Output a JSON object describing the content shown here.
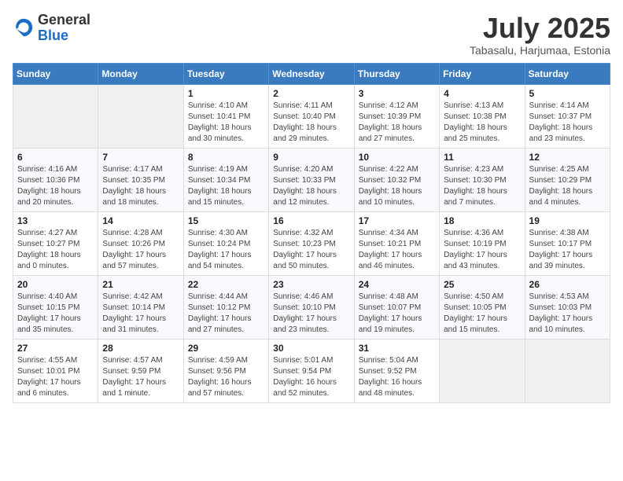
{
  "logo": {
    "general": "General",
    "blue": "Blue"
  },
  "title": "July 2025",
  "location": "Tabasalu, Harjumaa, Estonia",
  "weekdays": [
    "Sunday",
    "Monday",
    "Tuesday",
    "Wednesday",
    "Thursday",
    "Friday",
    "Saturday"
  ],
  "weeks": [
    [
      {
        "day": "",
        "info": ""
      },
      {
        "day": "",
        "info": ""
      },
      {
        "day": "1",
        "info": "Sunrise: 4:10 AM\nSunset: 10:41 PM\nDaylight: 18 hours and 30 minutes."
      },
      {
        "day": "2",
        "info": "Sunrise: 4:11 AM\nSunset: 10:40 PM\nDaylight: 18 hours and 29 minutes."
      },
      {
        "day": "3",
        "info": "Sunrise: 4:12 AM\nSunset: 10:39 PM\nDaylight: 18 hours and 27 minutes."
      },
      {
        "day": "4",
        "info": "Sunrise: 4:13 AM\nSunset: 10:38 PM\nDaylight: 18 hours and 25 minutes."
      },
      {
        "day": "5",
        "info": "Sunrise: 4:14 AM\nSunset: 10:37 PM\nDaylight: 18 hours and 23 minutes."
      }
    ],
    [
      {
        "day": "6",
        "info": "Sunrise: 4:16 AM\nSunset: 10:36 PM\nDaylight: 18 hours and 20 minutes."
      },
      {
        "day": "7",
        "info": "Sunrise: 4:17 AM\nSunset: 10:35 PM\nDaylight: 18 hours and 18 minutes."
      },
      {
        "day": "8",
        "info": "Sunrise: 4:19 AM\nSunset: 10:34 PM\nDaylight: 18 hours and 15 minutes."
      },
      {
        "day": "9",
        "info": "Sunrise: 4:20 AM\nSunset: 10:33 PM\nDaylight: 18 hours and 12 minutes."
      },
      {
        "day": "10",
        "info": "Sunrise: 4:22 AM\nSunset: 10:32 PM\nDaylight: 18 hours and 10 minutes."
      },
      {
        "day": "11",
        "info": "Sunrise: 4:23 AM\nSunset: 10:30 PM\nDaylight: 18 hours and 7 minutes."
      },
      {
        "day": "12",
        "info": "Sunrise: 4:25 AM\nSunset: 10:29 PM\nDaylight: 18 hours and 4 minutes."
      }
    ],
    [
      {
        "day": "13",
        "info": "Sunrise: 4:27 AM\nSunset: 10:27 PM\nDaylight: 18 hours and 0 minutes."
      },
      {
        "day": "14",
        "info": "Sunrise: 4:28 AM\nSunset: 10:26 PM\nDaylight: 17 hours and 57 minutes."
      },
      {
        "day": "15",
        "info": "Sunrise: 4:30 AM\nSunset: 10:24 PM\nDaylight: 17 hours and 54 minutes."
      },
      {
        "day": "16",
        "info": "Sunrise: 4:32 AM\nSunset: 10:23 PM\nDaylight: 17 hours and 50 minutes."
      },
      {
        "day": "17",
        "info": "Sunrise: 4:34 AM\nSunset: 10:21 PM\nDaylight: 17 hours and 46 minutes."
      },
      {
        "day": "18",
        "info": "Sunrise: 4:36 AM\nSunset: 10:19 PM\nDaylight: 17 hours and 43 minutes."
      },
      {
        "day": "19",
        "info": "Sunrise: 4:38 AM\nSunset: 10:17 PM\nDaylight: 17 hours and 39 minutes."
      }
    ],
    [
      {
        "day": "20",
        "info": "Sunrise: 4:40 AM\nSunset: 10:15 PM\nDaylight: 17 hours and 35 minutes."
      },
      {
        "day": "21",
        "info": "Sunrise: 4:42 AM\nSunset: 10:14 PM\nDaylight: 17 hours and 31 minutes."
      },
      {
        "day": "22",
        "info": "Sunrise: 4:44 AM\nSunset: 10:12 PM\nDaylight: 17 hours and 27 minutes."
      },
      {
        "day": "23",
        "info": "Sunrise: 4:46 AM\nSunset: 10:10 PM\nDaylight: 17 hours and 23 minutes."
      },
      {
        "day": "24",
        "info": "Sunrise: 4:48 AM\nSunset: 10:07 PM\nDaylight: 17 hours and 19 minutes."
      },
      {
        "day": "25",
        "info": "Sunrise: 4:50 AM\nSunset: 10:05 PM\nDaylight: 17 hours and 15 minutes."
      },
      {
        "day": "26",
        "info": "Sunrise: 4:53 AM\nSunset: 10:03 PM\nDaylight: 17 hours and 10 minutes."
      }
    ],
    [
      {
        "day": "27",
        "info": "Sunrise: 4:55 AM\nSunset: 10:01 PM\nDaylight: 17 hours and 6 minutes."
      },
      {
        "day": "28",
        "info": "Sunrise: 4:57 AM\nSunset: 9:59 PM\nDaylight: 17 hours and 1 minute."
      },
      {
        "day": "29",
        "info": "Sunrise: 4:59 AM\nSunset: 9:56 PM\nDaylight: 16 hours and 57 minutes."
      },
      {
        "day": "30",
        "info": "Sunrise: 5:01 AM\nSunset: 9:54 PM\nDaylight: 16 hours and 52 minutes."
      },
      {
        "day": "31",
        "info": "Sunrise: 5:04 AM\nSunset: 9:52 PM\nDaylight: 16 hours and 48 minutes."
      },
      {
        "day": "",
        "info": ""
      },
      {
        "day": "",
        "info": ""
      }
    ]
  ]
}
